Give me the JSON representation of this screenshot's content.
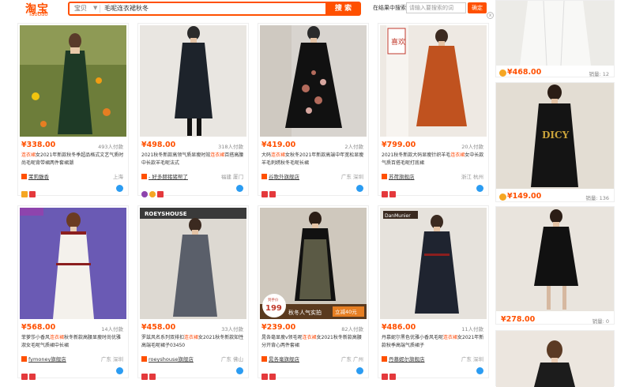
{
  "header": {
    "logo_cn": "淘宝",
    "logo_en": "Taobao",
    "scope": "宝贝",
    "query": "毛呢连衣裙秋冬",
    "search_button": "搜 索",
    "within_label": "在结果中搜索",
    "within_placeholder": "请输入要搜索的词",
    "within_button": "确定",
    "close": "x"
  },
  "products": [
    {
      "price": "¥338.00",
      "deals": "493人付款",
      "title_pre": "",
      "title_hl": "连衣裙",
      "title_post": "女2021年新款秋冬季超品格式文艺气质时尚毛呢背带裙两件套裙潮",
      "shop": "茉莉馥香",
      "loc": "上海",
      "badges": [
        "#f5a623",
        "#e4393c"
      ]
    },
    {
      "price": "¥498.00",
      "deals": "318人付款",
      "title_pre": "2021秋冬新款高领气质显瘦时效",
      "title_hl": "连衣裙",
      "title_post": "百搭高腰中长款羊毛呢法式",
      "shop": "- 好多赫猪猪帮了",
      "loc": "福建 厦门",
      "badges": [
        "#8e44ad",
        "#f5a623",
        "#e4393c"
      ]
    },
    {
      "price": "¥419.00",
      "deals": "2人付款",
      "title_pre": "大码",
      "title_hl": "连衣裙",
      "title_post": "女秋冬2021年新款高端中年宽松显瘦羊毛刺绣秋冬毛呢长裙",
      "shop": "谷歌外旗舰店",
      "loc": "广东 深圳",
      "badges": [
        "#e4393c",
        "#e4393c"
      ]
    },
    {
      "price": "¥799.00",
      "deals": "20人付款",
      "title_pre": "2021秋冬新款大码显瘦针织羊毛",
      "title_hl": "连衣裙",
      "title_post": "女中长款气质百搭毛呢打底裙",
      "shop": "苏荷旗舰店",
      "loc": "浙江 杭州",
      "badges": [
        "#e4393c",
        "#e4393c"
      ]
    },
    {
      "price": "¥568.00",
      "deals": "14人付款",
      "title_pre": "菲萝莎小香风",
      "title_hl": "连衣裙",
      "title_post": "秋冬新款高腰显瘦时尚优雅淑女毛呢气质裙中长裙",
      "shop": "fymoney旗舰店",
      "loc": "广东 深圳",
      "badges": [
        "#e4393c",
        "#e4393c"
      ]
    },
    {
      "price": "¥458.00",
      "deals": "33人付款",
      "title_pre": "罗兹风名系列双排扣",
      "title_hl": "连衣裙",
      "title_post": "女2021秋冬新款知性高端毛呢裙子03450",
      "shop": "roeyshouse旗舰店",
      "loc": "广东 佛山",
      "badges": [
        "#e4393c",
        "#e4393c"
      ]
    },
    {
      "price": "¥239.00",
      "deals": "82人付款",
      "title_pre": "晁各毫显瘦v领毛呢",
      "title_hl": "连衣裙",
      "title_post": "女2021秋冬新款高腰分开背心两件套裙",
      "shop": "晁各毫旗舰店",
      "loc": "广东 广州",
      "badges": [
        "#e4393c",
        "#e4393c"
      ]
    },
    {
      "price": "¥486.00",
      "deals": "11人付款",
      "title_pre": "丹慕妮尔黑色优雅小香风毛呢",
      "title_hl": "连衣裙",
      "title_post": "女2021年新款秋季高端气质裙子",
      "shop": "丹慕妮尔旗舰店",
      "loc": "广东 深圳",
      "badges": [
        "#e4393c",
        "#e4393c"
      ]
    }
  ],
  "right_items": [
    {
      "price": "¥468.00",
      "deals": "销量: 12"
    },
    {
      "price": "¥149.00",
      "deals": "销量: 136"
    },
    {
      "price": "¥278.00",
      "deals": "销量: 0"
    }
  ],
  "promo": {
    "tag": "秋冬人气实拍",
    "badge": "立减40元",
    "price": "199",
    "badge_top": "到手价"
  },
  "pic_text": {
    "roey": "ROEYSHOUSE",
    "dan": "DanMunier",
    "xi": "喜欢"
  }
}
